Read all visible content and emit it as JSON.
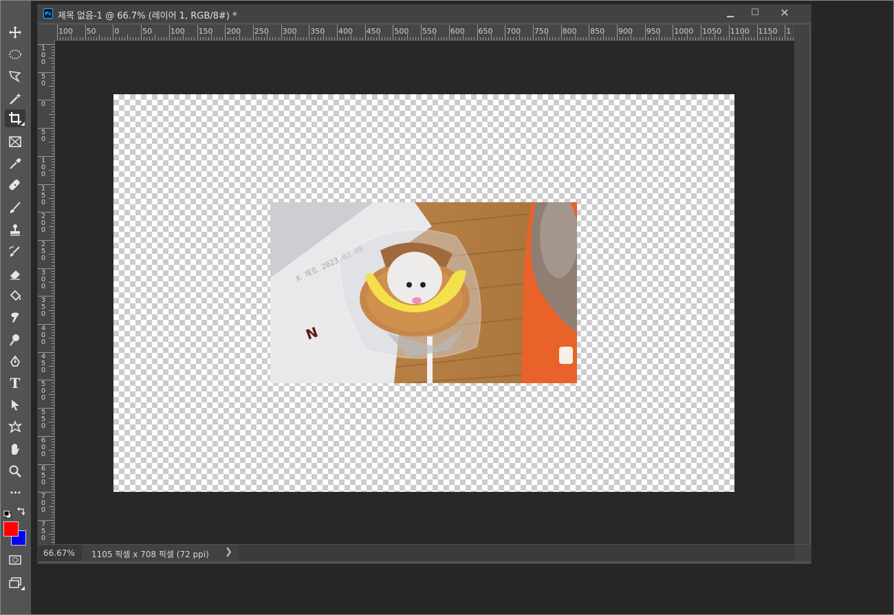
{
  "window": {
    "title": "제목 없음-1 @ 66.7% (레이어 1, RGB/8#) *",
    "app_icon": "Ps",
    "minimize_glyph": "▁",
    "maximize_glyph": "☐",
    "close_glyph": "✕"
  },
  "toolbar": {
    "tools": [
      {
        "name": "move-tool",
        "icon": "move-icon"
      },
      {
        "name": "ellipse-marquee-tool",
        "icon": "ellipse-marquee-icon"
      },
      {
        "name": "lasso-tool",
        "icon": "polygonal-lasso-icon"
      },
      {
        "name": "quick-selection-tool",
        "icon": "magic-wand-icon"
      },
      {
        "name": "crop-tool",
        "icon": "crop-icon",
        "active": true
      },
      {
        "name": "frame-tool",
        "icon": "frame-icon"
      },
      {
        "name": "eyedropper-tool",
        "icon": "eyedropper-icon"
      },
      {
        "name": "healing-brush-tool",
        "icon": "bandage-icon"
      },
      {
        "name": "brush-tool",
        "icon": "brush-icon"
      },
      {
        "name": "clone-stamp-tool",
        "icon": "stamp-icon"
      },
      {
        "name": "history-brush-tool",
        "icon": "history-brush-icon"
      },
      {
        "name": "eraser-tool",
        "icon": "eraser-icon"
      },
      {
        "name": "paint-bucket-tool",
        "icon": "paint-bucket-icon"
      },
      {
        "name": "smudge-tool",
        "icon": "smudge-icon"
      },
      {
        "name": "dodge-tool",
        "icon": "dodge-icon"
      },
      {
        "name": "pen-tool",
        "icon": "pen-icon"
      },
      {
        "name": "type-tool",
        "icon": "type-icon",
        "glyph": "T"
      },
      {
        "name": "path-selection-tool",
        "icon": "arrow-cursor-icon"
      },
      {
        "name": "custom-shape-tool",
        "icon": "custom-shape-icon"
      },
      {
        "name": "hand-tool",
        "icon": "hand-icon"
      },
      {
        "name": "zoom-tool",
        "icon": "zoom-icon"
      },
      {
        "name": "edit-toolbar",
        "icon": "more-dots-icon",
        "glyph": "•••"
      }
    ],
    "foreground_color": "#ff0000",
    "background_color": "#0000ff",
    "quick_mask": "quick-mask-icon",
    "screen_mode": "screen-mode-icon"
  },
  "rulers": {
    "horizontal_labels": [
      "100",
      "50",
      "0",
      "50",
      "100",
      "150",
      "200",
      "250",
      "300",
      "350",
      "400",
      "450",
      "500",
      "550",
      "600",
      "650",
      "700",
      "750",
      "800",
      "850",
      "900",
      "950",
      "1000",
      "1050",
      "1100",
      "1150",
      "1"
    ],
    "vertical_labels": [
      "1\n0\n0",
      "5\n0",
      "0",
      "5\n0",
      "1\n0\n0",
      "1\n5\n0",
      "2\n0\n0",
      "2\n5\n0",
      "3\n0\n0",
      "3\n5\n0",
      "4\n0\n0",
      "4\n5\n0",
      "5\n0\n0",
      "5\n5\n0",
      "6\n0\n0",
      "6\n5\n0",
      "7\n0\n0",
      "7\n5\n0"
    ]
  },
  "status": {
    "zoom": "66.67%",
    "doc_info": "1105 픽셀 x 708 픽셀 (72 ppi)",
    "arrow": "❯"
  },
  "colors": {
    "panel": "#535353",
    "pasteboard": "#282828",
    "accent": "#31a8ff"
  }
}
